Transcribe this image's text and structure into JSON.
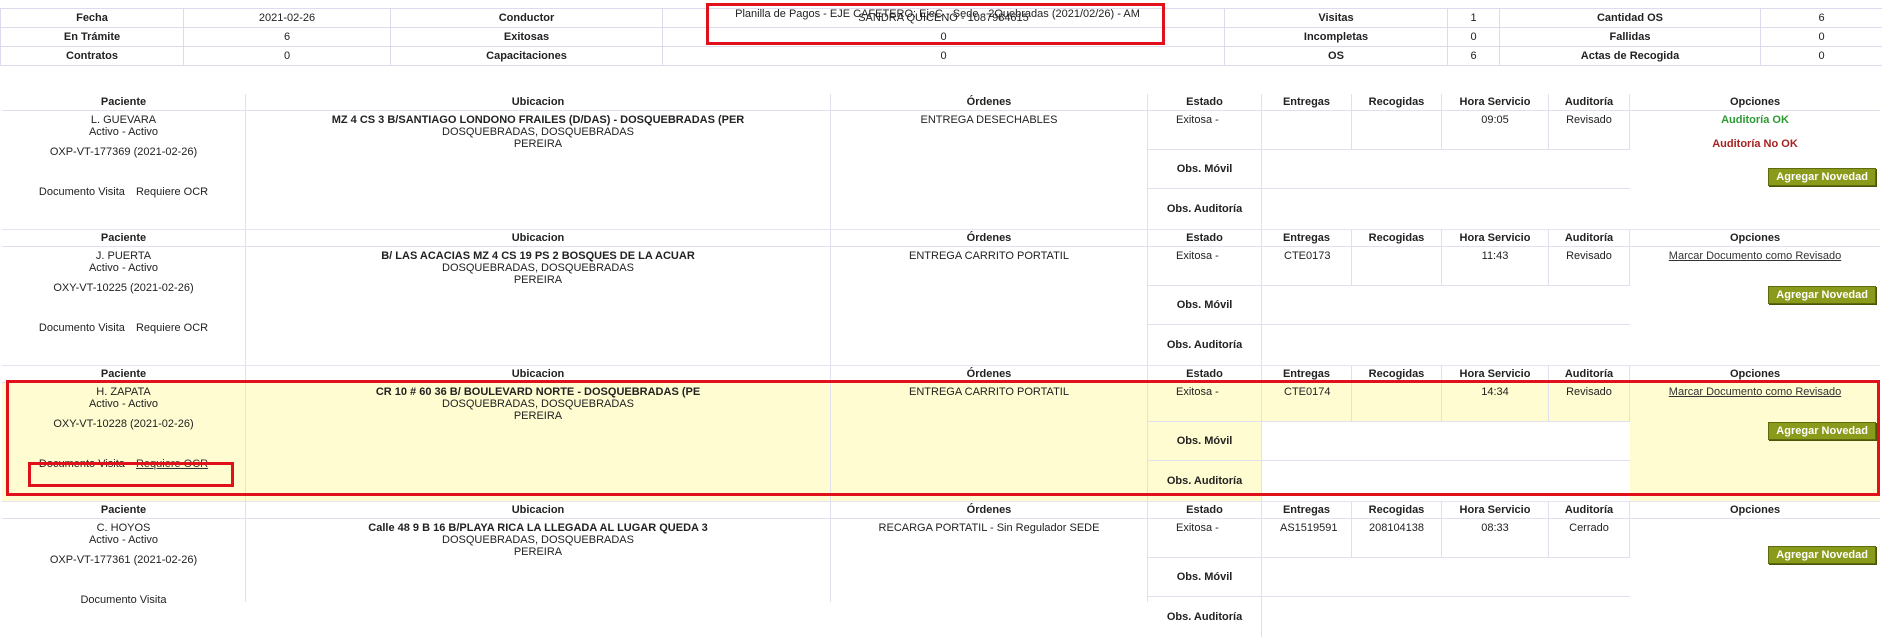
{
  "header": {
    "title": "Planilla de Pagos - EJE CAFETERO: EjeC - Sede - 2Quebradas (2021/02/26) - AM",
    "conductor_value": "SANDRA QUICENO - 1087984615",
    "rows": [
      {
        "k1": "Fecha",
        "v1": "2021-02-26",
        "k2": "Conductor",
        "k3": "Visitas",
        "v3": "1",
        "k4": "Cantidad OS",
        "v4": "6"
      },
      {
        "k1": "En Trámite",
        "v1": "6",
        "k2": "Exitosas",
        "v2": "0",
        "k3": "Incompletas",
        "v3": "0",
        "k4": "Fallidas",
        "v4": "0"
      },
      {
        "k1": "Contratos",
        "v1": "0",
        "k2": "Capacitaciones",
        "v2": "0",
        "k3": "OS",
        "v3": "6",
        "k4": "Actas de Recogida",
        "v4": "0"
      }
    ]
  },
  "columns": {
    "paciente": "Paciente",
    "ubicacion": "Ubicacion",
    "ordenes": "Órdenes",
    "estado": "Estado",
    "entregas": "Entregas",
    "recogidas": "Recogidas",
    "hora": "Hora Servicio",
    "auditoria": "Auditoría",
    "opciones": "Opciones"
  },
  "labels": {
    "obs_movil": "Obs. Móvil",
    "obs_auditoria": "Obs. Auditoría",
    "documento_visita": "Documento Visita",
    "requiere_ocr": "Requiere OCR",
    "agregar_novedad": "Agregar Novedad",
    "marcar_revisado": "Marcar Documento como Revisado",
    "auditoria_ok": "Auditoría OK",
    "auditoria_no_ok": "Auditoría No OK"
  },
  "records": [
    {
      "paciente": "L. GUEVARA",
      "estado_pac": "Activo - Activo",
      "codigo": "OXP-VT-177369 (2021-02-26)",
      "ubic1": "MZ 4 CS 3 B/SANTIAGO LONDONO FRAILES (D/DAS) - DOSQUEBRADAS (PER",
      "ubic2": "DOSQUEBRADAS, DOSQUEBRADAS",
      "ubic3": "PEREIRA",
      "orden": "ENTREGA DESECHABLES",
      "estado": "Exitosa -",
      "entregas": "",
      "recogidas": "",
      "hora": "09:05",
      "auditoria": "Revisado"
    },
    {
      "paciente": "J. PUERTA",
      "estado_pac": "Activo - Activo",
      "codigo": "OXY-VT-10225 (2021-02-26)",
      "ubic1": "B/ LAS ACACIAS MZ 4 CS 19 PS 2 BOSQUES DE LA ACUAR",
      "ubic2": "DOSQUEBRADAS, DOSQUEBRADAS",
      "ubic3": "PEREIRA",
      "orden": "ENTREGA CARRITO PORTATIL",
      "estado": "Exitosa -",
      "entregas": "CTE0173",
      "recogidas": "",
      "hora": "11:43",
      "auditoria": "Revisado"
    },
    {
      "paciente": "H. ZAPATA",
      "estado_pac": "Activo - Activo",
      "codigo": "OXY-VT-10228 (2021-02-26)",
      "ubic1": "CR 10 # 60 36 B/ BOULEVARD NORTE - DOSQUEBRADAS (PE",
      "ubic2": "DOSQUEBRADAS, DOSQUEBRADAS",
      "ubic3": "PEREIRA",
      "orden": "ENTREGA CARRITO PORTATIL",
      "estado": "Exitosa -",
      "entregas": "CTE0174",
      "recogidas": "",
      "hora": "14:34",
      "auditoria": "Revisado"
    },
    {
      "paciente": "C. HOYOS",
      "estado_pac": "Activo - Activo",
      "codigo": "OXP-VT-177361 (2021-02-26)",
      "ubic1": "Calle 48 9 B 16 B/PLAYA RICA LA LLEGADA AL LUGAR QUEDA 3",
      "ubic2": "DOSQUEBRADAS, DOSQUEBRADAS",
      "ubic3": "PEREIRA",
      "orden": "RECARGA PORTATIL - Sin Regulador SEDE",
      "estado": "Exitosa -",
      "entregas": "AS1519591",
      "recogidas": "208104138",
      "hora": "08:33",
      "auditoria": "Cerrado"
    }
  ],
  "colors": {
    "highlight": "#e0111a",
    "selected_row": "#fefcd0",
    "button": "#8a9a1a"
  }
}
